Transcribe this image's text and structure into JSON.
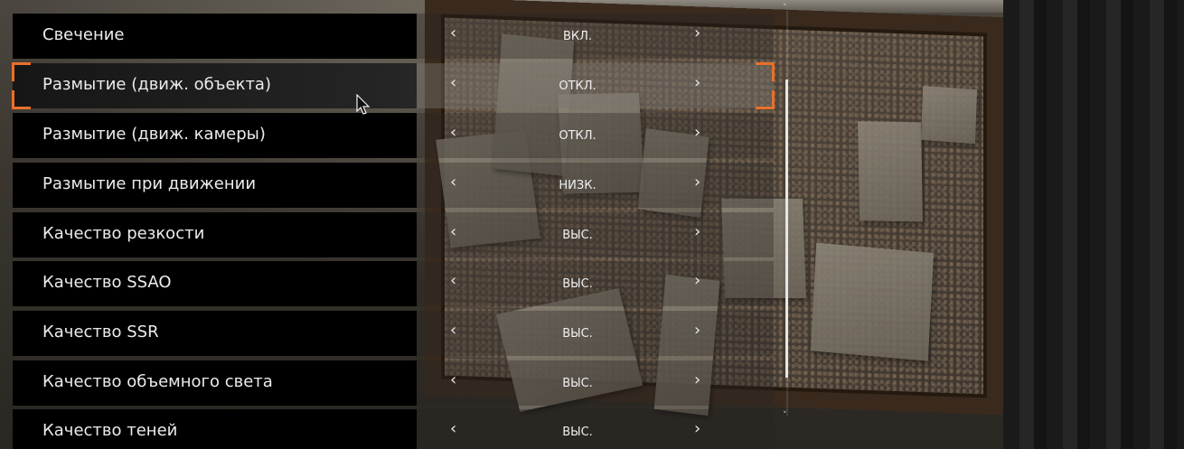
{
  "settings": [
    {
      "label": "Свечение",
      "value": "ВКЛ."
    },
    {
      "label": "Размытие (движ. объекта)",
      "value": "ОТКЛ."
    },
    {
      "label": "Размытие (движ. камеры)",
      "value": "ОТКЛ."
    },
    {
      "label": "Размытие при движении",
      "value": "НИЗК."
    },
    {
      "label": "Качество резкости",
      "value": "ВЫС."
    },
    {
      "label": "Качество SSAO",
      "value": "ВЫС."
    },
    {
      "label": "Качество SSR",
      "value": "ВЫС."
    },
    {
      "label": "Качество объемного света",
      "value": "ВЫС."
    },
    {
      "label": "Качество теней",
      "value": "ВЫС."
    }
  ],
  "selected_index": 1,
  "arrows": {
    "left": "‹",
    "right": "›"
  },
  "colors": {
    "selection_bracket": "#e8702a",
    "row_bg": "#000000",
    "text": "#ececec"
  },
  "icons": [
    "chevron-left-icon",
    "chevron-right-icon",
    "mouse-cursor-icon"
  ]
}
